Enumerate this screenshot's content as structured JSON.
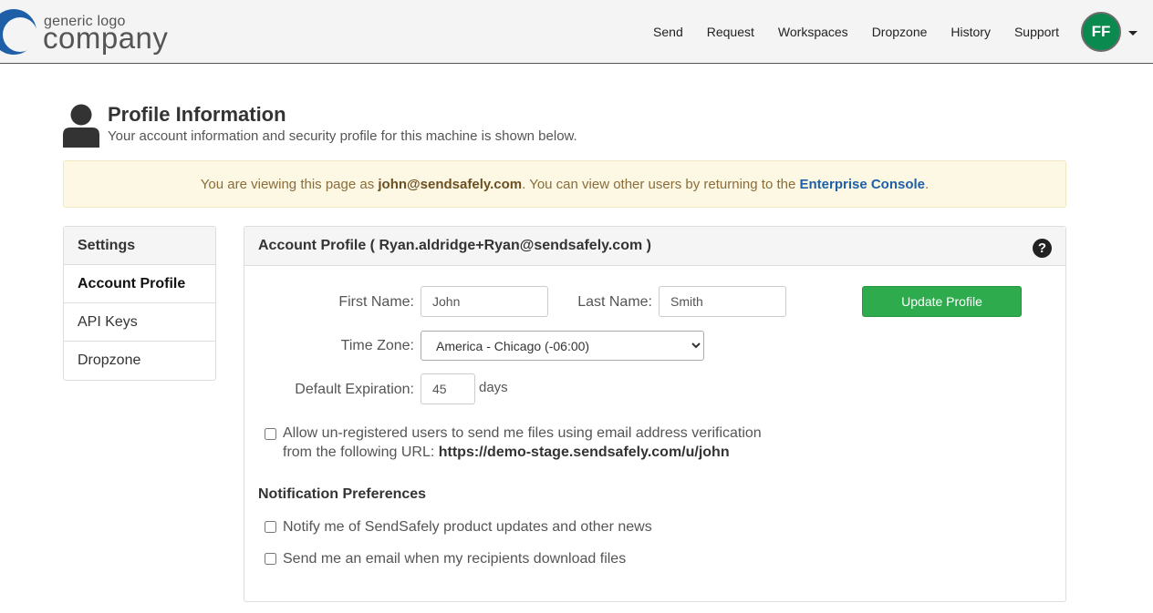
{
  "logo": {
    "small": "generic logo",
    "big": "company",
    "brand_color": "#1f5fa8"
  },
  "nav": {
    "links": [
      "Send",
      "Request",
      "Workspaces",
      "Dropzone",
      "History",
      "Support"
    ],
    "avatar_initials": "FF",
    "avatar_color": "#0a8a4f"
  },
  "header": {
    "title": "Profile Information",
    "subtitle": "Your account information and security profile for this machine is shown below."
  },
  "alert": {
    "prefix": "You are viewing this page as ",
    "email": "john@sendsafely.com",
    "middle": ". You can view other users by returning to the ",
    "link": "Enterprise Console",
    "suffix": "."
  },
  "sidebar": {
    "heading": "Settings",
    "items": [
      "Account Profile",
      "API Keys",
      "Dropzone"
    ]
  },
  "panel": {
    "title": "Account Profile ( Ryan.aldridge+Ryan@sendsafely.com )",
    "help": "?",
    "first_name_label": "First Name:",
    "first_name_value": "John",
    "last_name_label": "Last Name:",
    "last_name_value": "Smith",
    "update_button": "Update Profile",
    "timezone_label": "Time Zone:",
    "timezone_value": "America - Chicago (-06:00)",
    "expiration_label": "Default Expiration:",
    "expiration_value": "45",
    "expiration_unit": "days",
    "unregistered_line1": "Allow un-registered users to send me files using email address verification",
    "unregistered_line2_prefix": "from the following URL: ",
    "unregistered_url": "https://demo-stage.sendsafely.com/u/john",
    "notification_title": "Notification Preferences",
    "notify_updates": "Notify me of SendSafely product updates and other news",
    "notify_download": "Send me an email when my recipients download files"
  }
}
